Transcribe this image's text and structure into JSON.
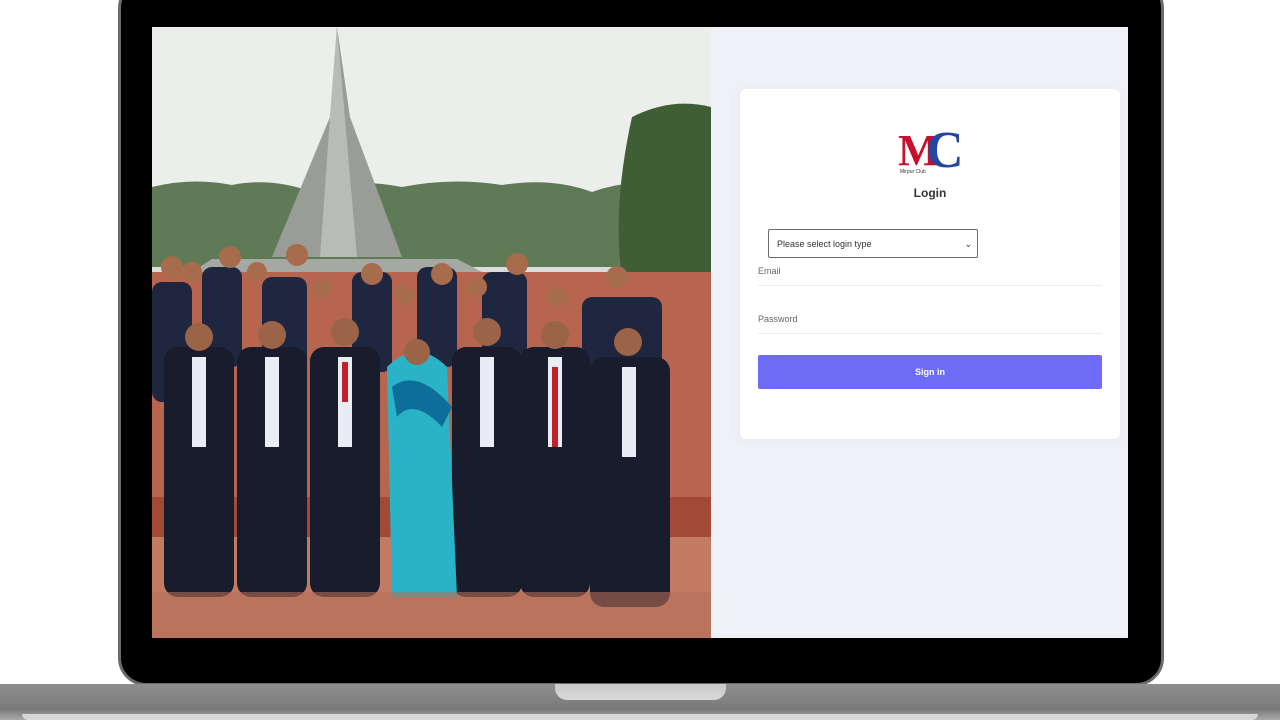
{
  "login": {
    "logo_text": "MC",
    "logo_subtext": "Mirpur Club",
    "title": "Login",
    "login_type_select": {
      "selected": "Please select login type"
    },
    "email_label": "Email",
    "password_label": "Password",
    "sign_in_label": "Sign in"
  },
  "colors": {
    "accent": "#6e6cf7",
    "logo_red": "#c8102e",
    "logo_blue": "#2346a0",
    "panel_bg": "#f0f0f7"
  },
  "icons": {
    "select_chevron": "chevron-down-icon"
  }
}
